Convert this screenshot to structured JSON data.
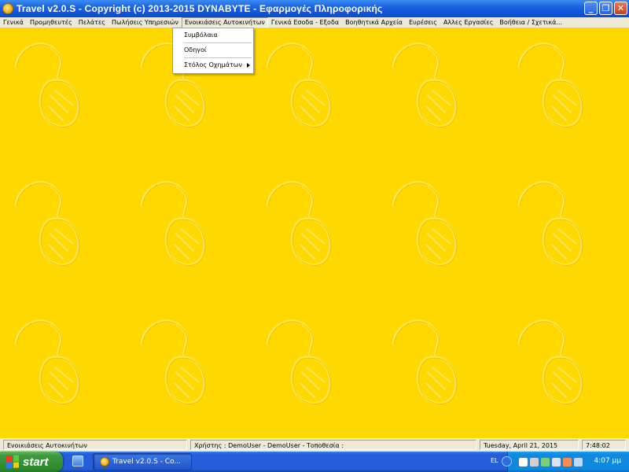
{
  "window": {
    "title": "Travel  v2.0.S  -  Copyright (c)  2013-2015  DYNABYTE - Εφαρμογές Πληροφορικής",
    "controls": {
      "minimize": "_",
      "maximize": "❐",
      "close": "✕"
    }
  },
  "menubar": {
    "items": [
      "Γενικά",
      "Προμηθευτές",
      "Πελάτες",
      "Πωλήσεις Υπηρεσιών",
      "Ενοικιάσεις Αυτοκινήτων",
      "Γενικά Εσοδα - Εξοδα",
      "Βοηθητικά Αρχεία",
      "Ευρέσεις",
      "Αλλες Εργασίες",
      "Βοήθεια / Σχετικά..."
    ],
    "active_index": 4
  },
  "dropdown": {
    "items": [
      "Συμβόλαια",
      "Οδηγοί",
      "Στόλος Οχημάτων"
    ]
  },
  "statusbar": {
    "module": "Ενοικιάσεις Αυτοκινήτων",
    "user": "Χρήστης : DemoUser  -  DemoUser  -  Τοποθεσία :",
    "date": "Tuesday, April 21, 2015",
    "time": "7:48:02"
  },
  "taskbar": {
    "start_label": "start",
    "task_label": "Travel  v2.0.S  - Co...",
    "language": "EL",
    "clock": "4:07 μμ"
  },
  "colors": {
    "background": "#ffd800",
    "titlebar": "#0a4ad0",
    "menubar": "#ece9d8",
    "taskbar": "#245edb",
    "start": "#3c9a3c"
  },
  "icons": [
    "app-icon",
    "windows-logo-icon",
    "quick-launch-icon",
    "submenu-arrow-icon",
    "tray-icon"
  ]
}
